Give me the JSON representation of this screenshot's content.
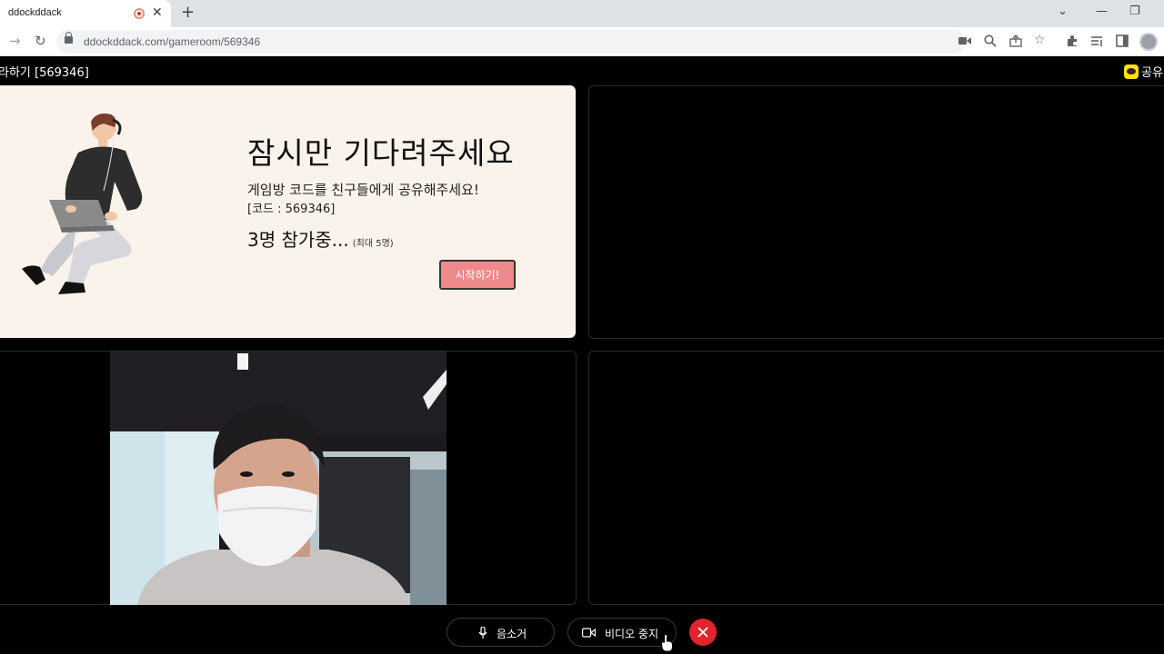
{
  "browser": {
    "tab_title": "ddockddack",
    "tab_close": "✕",
    "new_tab": "+",
    "window_controls": {
      "minimize": "—",
      "restore": "❐",
      "chevron": "⌄"
    },
    "url": "ddockddack.com/gameroom/569346",
    "icons": [
      "back-arrow-icon",
      "reload-icon",
      "lock-icon",
      "camera-icon",
      "zoom-icon",
      "share-icon",
      "star-icon",
      "extensions-icon",
      "reading-list-icon",
      "side-panel-icon",
      "profile-avatar"
    ]
  },
  "header": {
    "room_title": "라하기 [569346]",
    "share_label": "공유"
  },
  "waiting": {
    "title": "잠시만 기다려주세요",
    "subtitle": "게임방 코드를 친구들에게 공유해주세요!",
    "code_line": "[코드 : 569346]",
    "participants": "3명 참가중...",
    "max_note": "(최대 5명)",
    "start_button": "시작하기!"
  },
  "controls": {
    "mute_label": "음소거",
    "video_label": "비디오 중지",
    "leave_icon": "✕"
  },
  "colors": {
    "card_bg": "#faf3eb",
    "start_button": "#ef8a8a",
    "leave_button": "#e1242d",
    "kakao": "#fee500"
  }
}
